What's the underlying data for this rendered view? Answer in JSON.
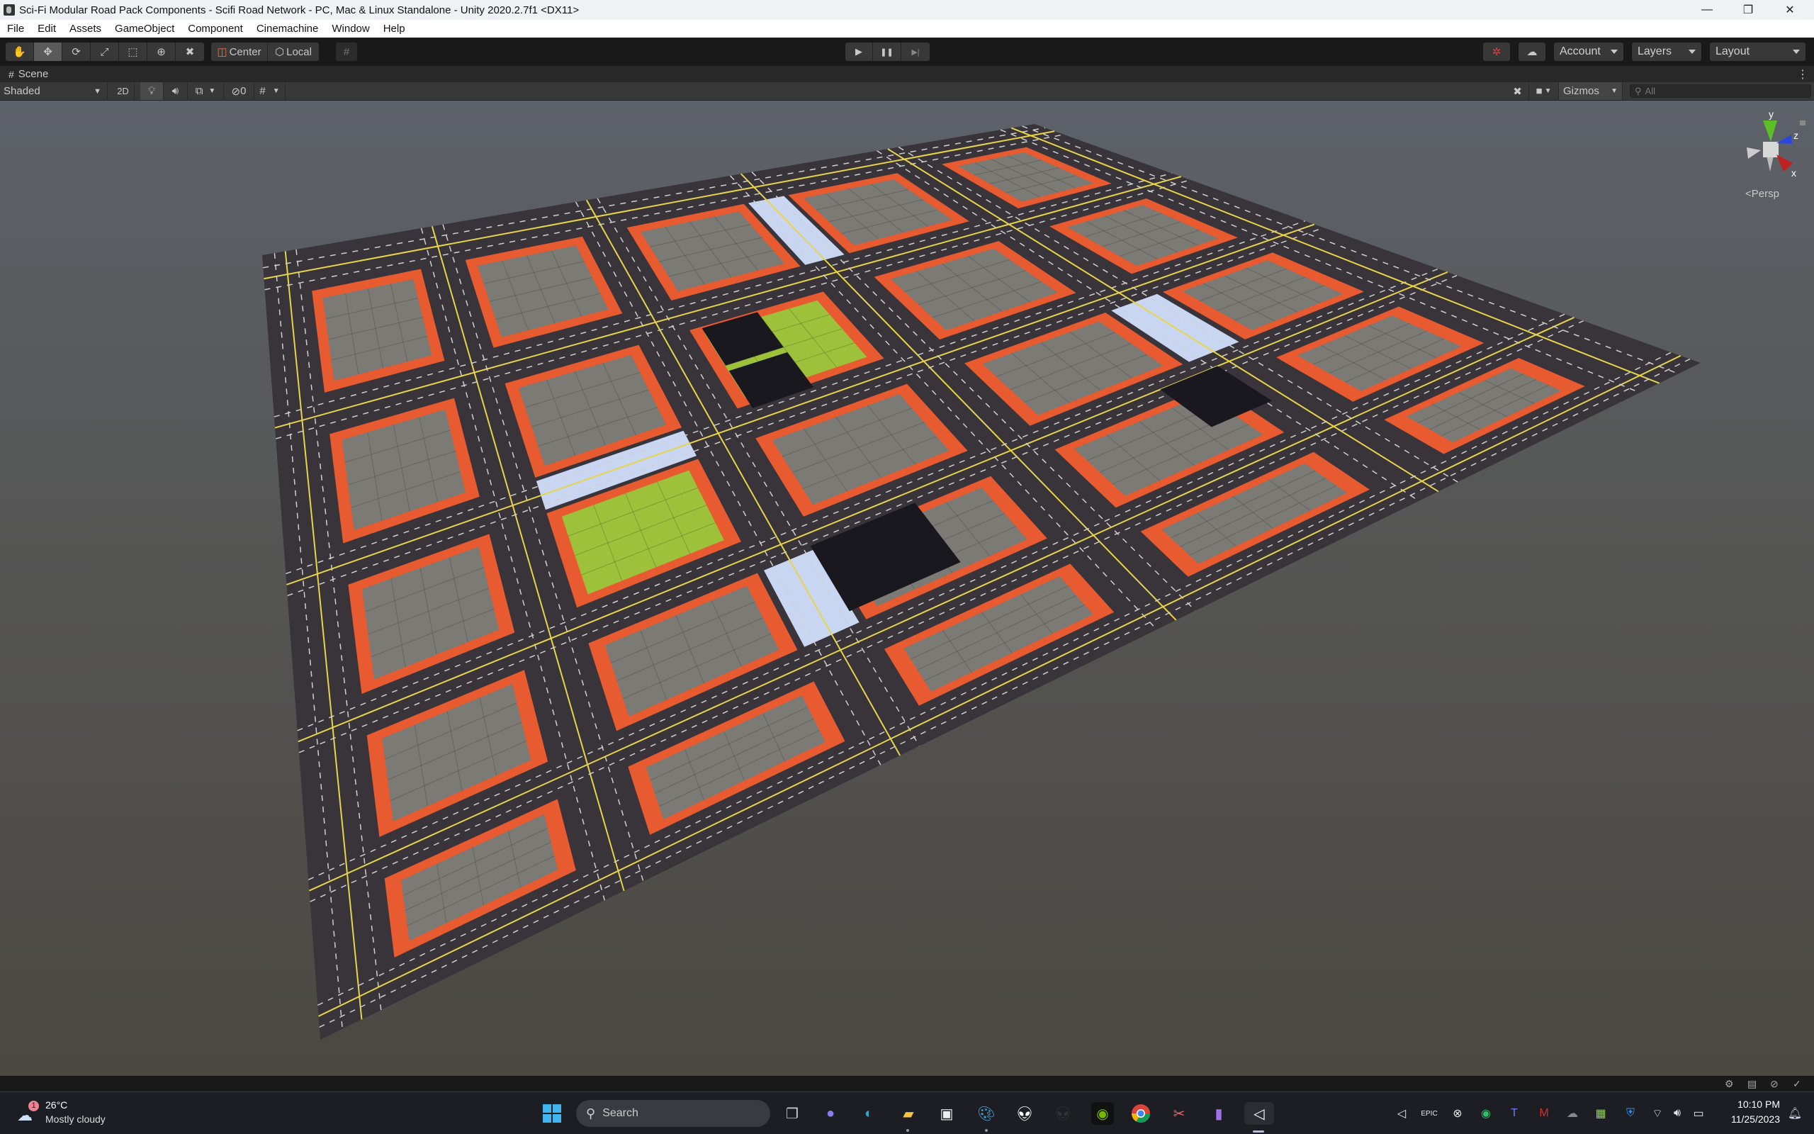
{
  "window": {
    "title": "Sci-Fi Modular Road Pack Components - Scifi Road Network - PC, Mac & Linux Standalone - Unity 2020.2.7f1 <DX11>",
    "controls": [
      "minimize",
      "restore",
      "close"
    ]
  },
  "menu": [
    "File",
    "Edit",
    "Assets",
    "GameObject",
    "Component",
    "Cinemachine",
    "Window",
    "Help"
  ],
  "toolbar": {
    "tools": [
      {
        "name": "hand-tool",
        "glyph": "✋"
      },
      {
        "name": "move-tool",
        "glyph": "✥",
        "active": true
      },
      {
        "name": "rotate-tool",
        "glyph": "⟳"
      },
      {
        "name": "scale-tool",
        "glyph": "⤢"
      },
      {
        "name": "rect-tool",
        "glyph": "⬚"
      },
      {
        "name": "transform-tool",
        "glyph": "⊕"
      },
      {
        "name": "custom-tool",
        "glyph": "✖"
      }
    ],
    "pivot_mode": "Center",
    "pivot_rotation": "Local",
    "snap_glyph": "#",
    "play": "▶",
    "pause": "❚❚",
    "step": "▶|",
    "account": "Account",
    "layers": "Layers",
    "layout": "Layout"
  },
  "scene_tab": {
    "label": "Scene",
    "more": "⋮"
  },
  "scene_toolbar": {
    "draw_mode": "Shaded",
    "mode_2d": "2D",
    "hidden_count": "0",
    "gizmos": "Gizmos",
    "search_placeholder": "All"
  },
  "gizmo": {
    "axes": [
      "y",
      "z",
      "x"
    ],
    "projection": "Persp"
  },
  "scene": {
    "colors": {
      "sky": "#5d6169",
      "ground": "#4b4842",
      "road": "#38343a",
      "curb": "#e85a30",
      "curb_edge": "#f08a2a",
      "block": "#7b7a74",
      "park": "#9dc13a",
      "water": "#c9d6f2",
      "building": "#18181e",
      "line_yellow": "#e8d44a"
    }
  },
  "taskbar": {
    "weather_temp": "26°C",
    "weather_desc": "Mostly cloudy",
    "weather_badge": "1",
    "search_placeholder": "Search",
    "apps": [
      "task-view",
      "teams-chat",
      "edge",
      "file-explorer",
      "microsoft-store",
      "paint",
      "alienware",
      "alienware-command",
      "nvidia",
      "chrome",
      "snipping-tool",
      "clipchamp",
      "unity"
    ],
    "clock_time": "10:10 PM",
    "clock_date": "11/25/2023"
  }
}
